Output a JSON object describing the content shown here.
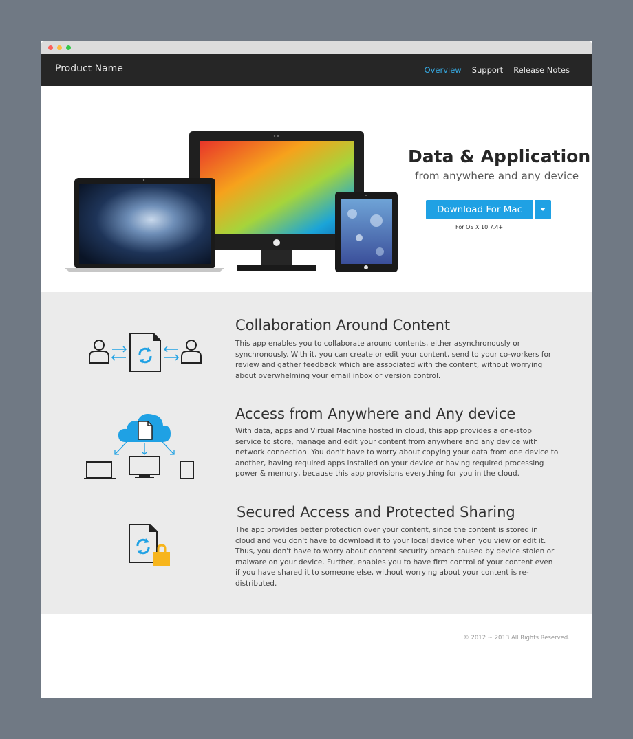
{
  "brand": {
    "name": "Product Name"
  },
  "nav": {
    "items": [
      {
        "label": "Overview",
        "active": true
      },
      {
        "label": "Support",
        "active": false
      },
      {
        "label": "Release Notes",
        "active": false
      }
    ]
  },
  "hero": {
    "title": "Data & Application",
    "subtitle": "from anywhere and any device",
    "download_label": "Download For Mac",
    "os_note": "For OS X 10.7.4+"
  },
  "features": [
    {
      "icon": "collaboration-icon",
      "title": "Collaboration Around Content",
      "text": "This app enables you to collaborate around contents, either asynchronously or synchronously. With it, you can create or edit your content, send to your co-workers for review and gather feedback which are associated with the content, without worrying about overwhelming your email inbox or version control."
    },
    {
      "icon": "cloud-devices-icon",
      "title": "Access from Anywhere and Any device",
      "text": "With data, apps and Virtual Machine hosted in cloud, this app provides a one-stop service to store, manage and edit your content from anywhere and any device with network connection. You don't have to worry about copying your data from one device to another, having required apps installed on your device or having required processing power & memory, because this app provisions everything for you in the cloud."
    },
    {
      "icon": "secure-document-icon",
      "title": "Secured Access and Protected Sharing",
      "text": "The app provides better protection over your content, since the content is stored in cloud and you don't have to download it to your local device when you view or edit it. Thus, you don't have to worry about content security breach caused by device stolen or malware on your device. Further,  enables you to have firm control of your content even if you have shared it to someone else, without worrying about your content is re-distributed."
    }
  ],
  "footer": {
    "copyright": "© 2012 ~ 2013  All Rights Reserved."
  },
  "colors": {
    "accent": "#1fa1e4",
    "navbar": "#262626",
    "nav_active": "#36a9e1",
    "lock": "#f7b51c"
  }
}
